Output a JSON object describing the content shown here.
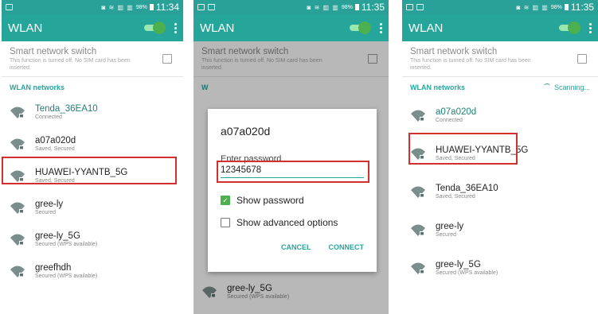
{
  "screens": [
    {
      "time": "11:34",
      "battery": "98%",
      "title": "WLAN",
      "smart_switch": {
        "title": "Smart network switch",
        "subtitle": "This function is turned off. No SIM card has been inserted."
      },
      "section_label": "WLAN networks",
      "networks": [
        {
          "name": "Tenda_36EA10",
          "status": "Connected"
        },
        {
          "name": "a07a020d",
          "status": "Saved, Secured"
        },
        {
          "name": "HUAWEI-YYANTB_5G",
          "status": "Saved, Secured"
        },
        {
          "name": "gree-ly",
          "status": "Secured"
        },
        {
          "name": "gree-ly_5G",
          "status": "Secured (WPS available)"
        },
        {
          "name": "greefhdh",
          "status": "Secured (WPS available)"
        }
      ]
    },
    {
      "time": "11:35",
      "battery": "98%",
      "title": "WLAN",
      "smart_switch": {
        "title": "Smart network switch",
        "subtitle": "This function is turned off. No SIM card has been inserted."
      },
      "section_label": "W",
      "dialog": {
        "title": "a07a020d",
        "password_label": "Enter password",
        "password_value": "12345678",
        "show_password": "Show password",
        "show_advanced": "Show advanced options",
        "cancel": "CANCEL",
        "connect": "CONNECT"
      },
      "networks": [
        {
          "name": "gree-ly_5G",
          "status": "Secured (WPS available)"
        }
      ]
    },
    {
      "time": "11:35",
      "battery": "98%",
      "title": "WLAN",
      "smart_switch": {
        "title": "Smart network switch",
        "subtitle": "This function is turned off. No SIM card has been inserted."
      },
      "section_label": "WLAN networks",
      "scanning": "Scanning...",
      "networks": [
        {
          "name": "a07a020d",
          "status": "Connected"
        },
        {
          "name": "HUAWEI-YYANTB_5G",
          "status": "Saved, Secured"
        },
        {
          "name": "Tenda_36EA10",
          "status": "Saved, Secured"
        },
        {
          "name": "gree-ly",
          "status": "Secured"
        },
        {
          "name": "gree-ly_5G",
          "status": "Secured (WPS available)"
        }
      ]
    }
  ],
  "colors": {
    "accent": "#26a69a",
    "toggle": "#4caf50",
    "highlight": "#d32f2f"
  },
  "icons": {
    "network": "wifi-lock-icon",
    "menu": "more-vert-icon",
    "toggle": "toggle-icon"
  }
}
